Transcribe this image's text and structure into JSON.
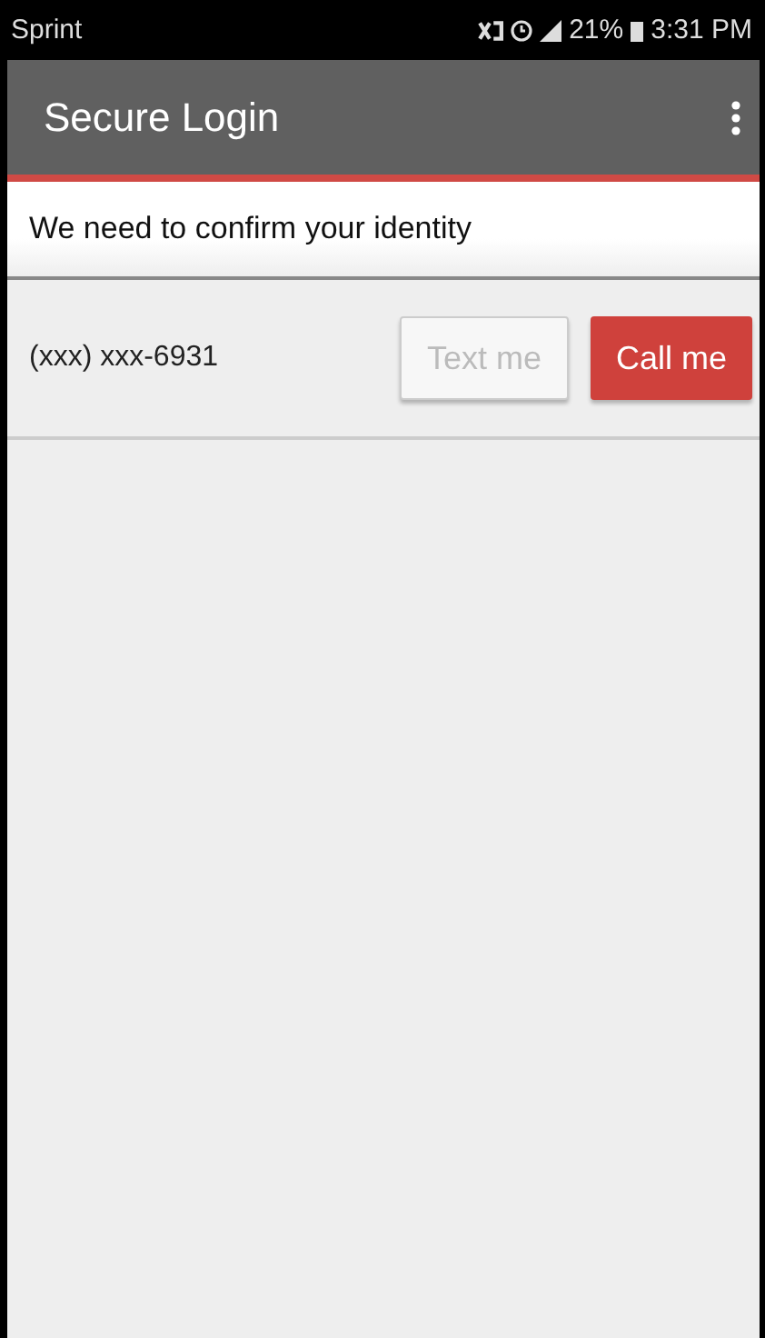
{
  "status_bar": {
    "carrier": "Sprint",
    "battery": "21%",
    "time": "3:31 PM"
  },
  "toolbar": {
    "title": "Secure Login"
  },
  "header": {
    "text": "We need to confirm your identity"
  },
  "phones": [
    {
      "number": "(xxx) xxx-6931",
      "buttons": [
        {
          "label": "Text me",
          "kind": "plain",
          "disabled": true
        },
        {
          "label": "Call me",
          "kind": "primary",
          "disabled": false
        }
      ]
    }
  ]
}
